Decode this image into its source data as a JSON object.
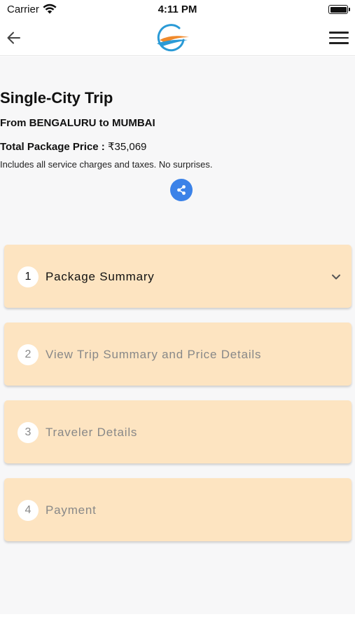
{
  "status_bar": {
    "carrier": "Carrier",
    "time": "4:11 PM"
  },
  "nav": {
    "back_icon": "arrow-left-icon",
    "logo": "brand-swoosh-logo",
    "menu_icon": "hamburger-menu-icon"
  },
  "trip": {
    "title": "Single-City Trip",
    "route": "From BENGALURU to MUMBAI",
    "price_label": "Total Package Price :",
    "price_value": "₹35,069",
    "note": "Includes all service charges and taxes. No surprises.",
    "share_icon": "share-icon"
  },
  "steps": [
    {
      "number": "1",
      "label": "Package Summary",
      "active": true
    },
    {
      "number": "2",
      "label": "View Trip Summary and Price Details",
      "active": false
    },
    {
      "number": "3",
      "label": "Traveler Details",
      "active": false
    },
    {
      "number": "4",
      "label": "Payment",
      "active": false
    }
  ],
  "colors": {
    "card_bg": "#fde4c1",
    "share_button": "#3b82e8",
    "logo_blue": "#2a9ad6",
    "logo_orange": "#f08a2c"
  }
}
